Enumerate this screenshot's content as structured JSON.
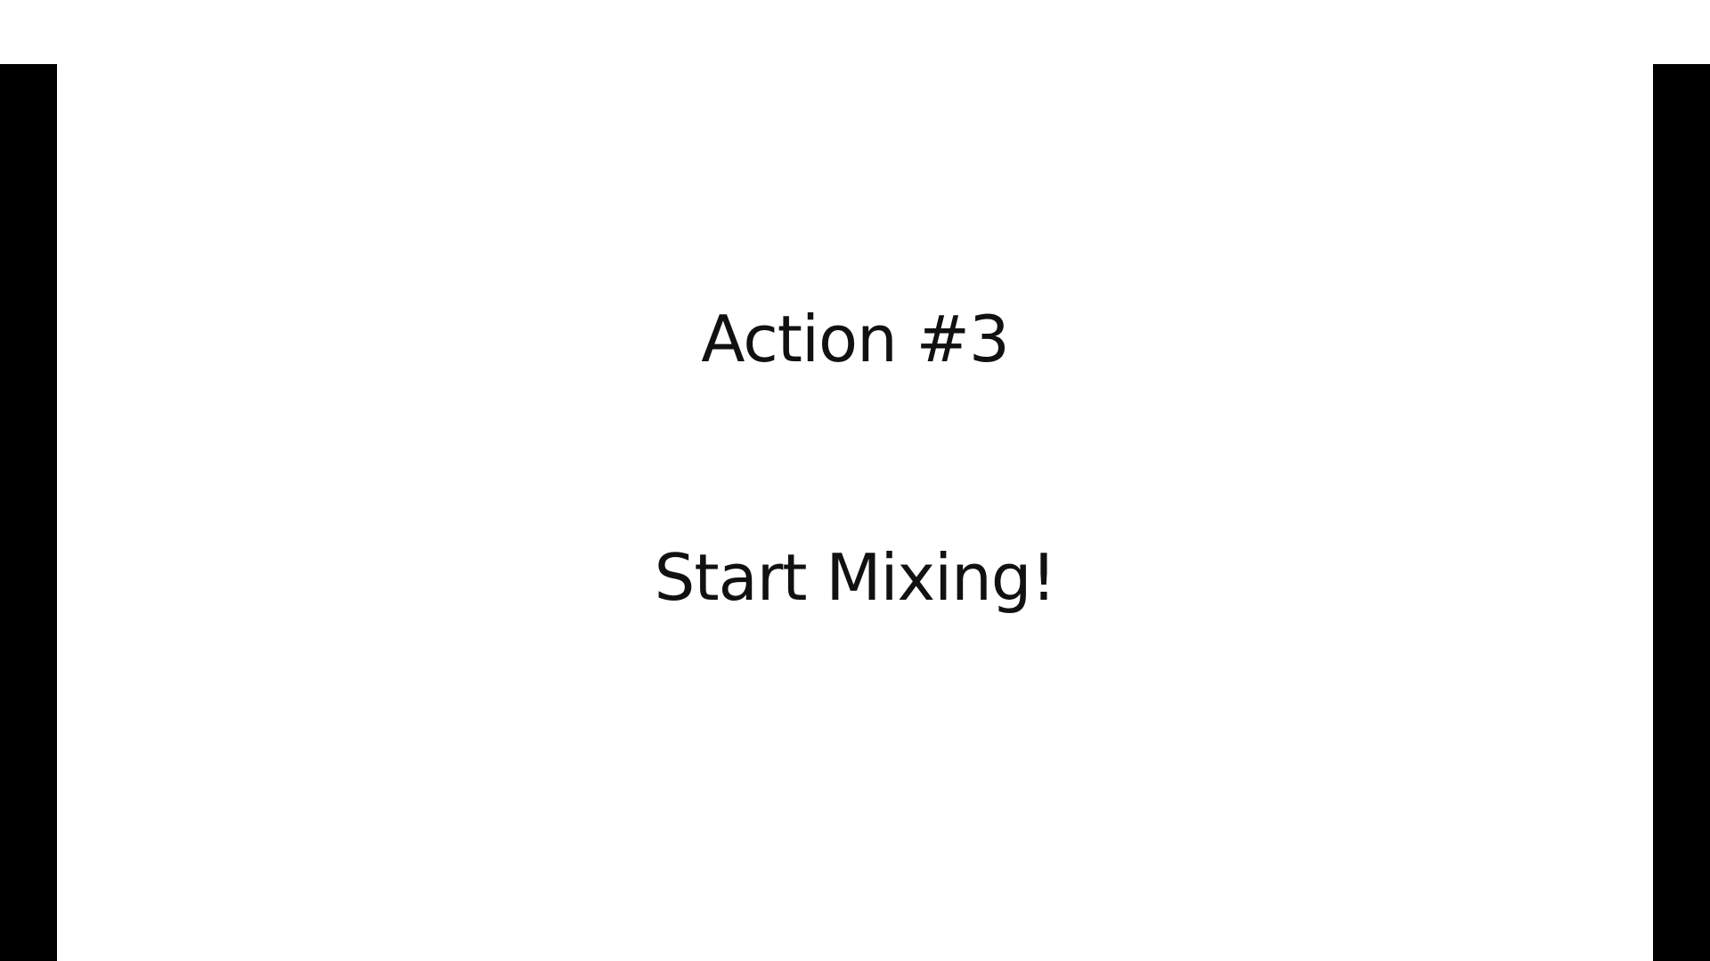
{
  "slide": {
    "title": "Action #3",
    "subtitle": "Start Mixing!"
  },
  "colors": {
    "background": "#ffffff",
    "pillarbox": "#000000",
    "text": "#111111"
  }
}
